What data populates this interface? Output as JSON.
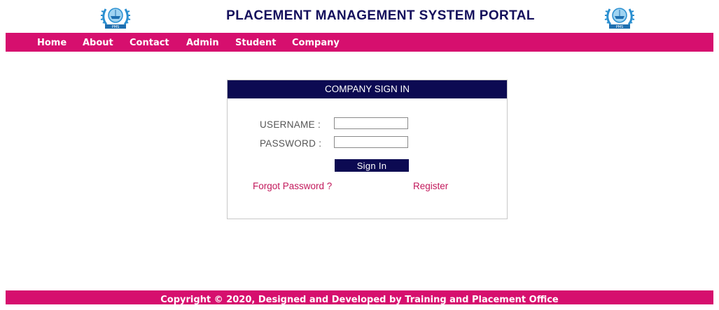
{
  "header": {
    "title": "PLACEMENT MANAGEMENT SYSTEM PORTAL",
    "logo_left": {
      "icon": "laurel-emblem-icon",
      "text": "PMS"
    },
    "logo_right": {
      "icon": "laurel-emblem-icon",
      "text": "PMS"
    }
  },
  "nav": {
    "items": [
      {
        "label": "Home"
      },
      {
        "label": "About"
      },
      {
        "label": "Contact"
      },
      {
        "label": "Admin"
      },
      {
        "label": "Student"
      },
      {
        "label": "Company"
      }
    ]
  },
  "signin": {
    "heading": "COMPANY SIGN IN",
    "username_label": "USERNAME :",
    "username_value": "",
    "password_label": "PASSWORD :",
    "password_value": "",
    "button_label": "Sign In",
    "forgot_label": "Forgot Password ?",
    "register_label": "Register"
  },
  "footer": {
    "text": "Copyright © 2020, Designed and Developed by Training and Placement Office"
  },
  "colors": {
    "navbar": "#d60f6e",
    "title": "#140f5c",
    "card_header": "#0c0a52",
    "link": "#c2185b"
  }
}
